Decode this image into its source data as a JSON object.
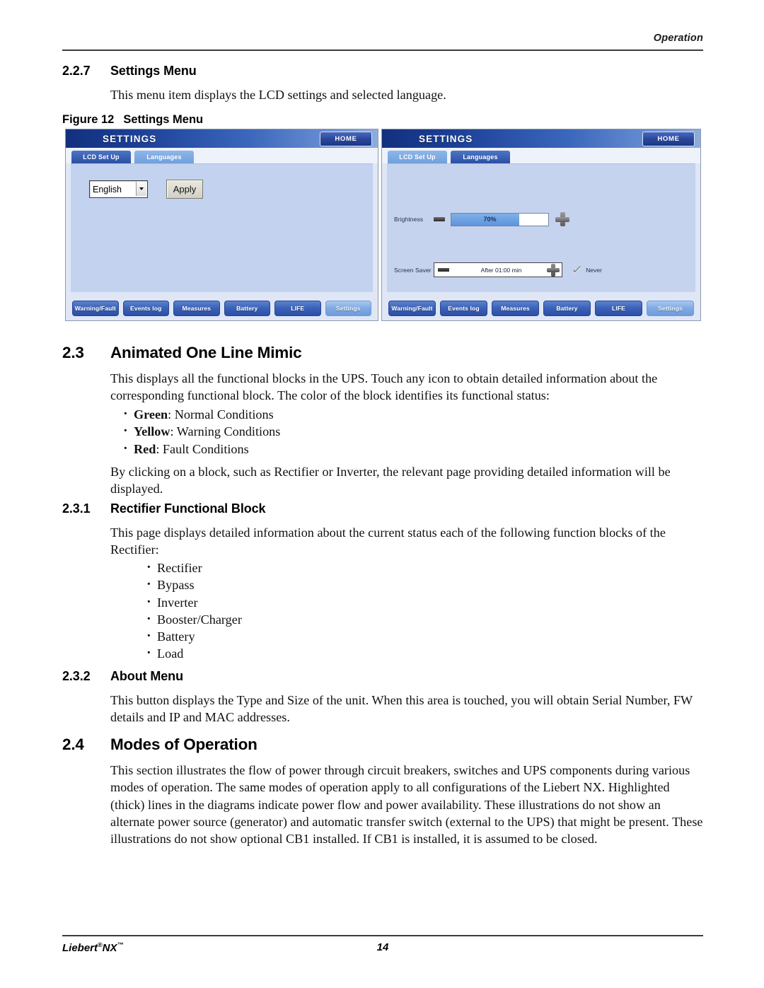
{
  "header": {
    "running_head": "Operation"
  },
  "sections": {
    "s227": {
      "number": "2.2.7",
      "title": "Settings Menu",
      "body": "This menu item displays the LCD settings and selected language."
    },
    "figure": {
      "label": "Figure 12",
      "title": "Settings Menu"
    },
    "s23": {
      "number": "2.3",
      "title": "Animated One Line Mimic",
      "body": "This displays all the functional blocks in the UPS. Touch any icon to obtain detailed information about the corresponding functional block. The color of the block identifies its functional status:",
      "bullets": [
        {
          "term": "Green",
          "rest": ": Normal Conditions"
        },
        {
          "term": "Yellow",
          "rest": ": Warning Conditions"
        },
        {
          "term": "Red",
          "rest": ": Fault Conditions"
        }
      ],
      "body2": "By clicking on a block, such as Rectifier or Inverter, the relevant page providing detailed information will be displayed."
    },
    "s231": {
      "number": "2.3.1",
      "title": "Rectifier Functional Block",
      "body": "This page displays detailed information about the current status each of the following function blocks of the Rectifier:",
      "bullets": [
        "Rectifier",
        "Bypass",
        "Inverter",
        "Booster/Charger",
        "Battery",
        "Load"
      ]
    },
    "s232": {
      "number": "2.3.2",
      "title": "About Menu",
      "body": "This button displays the Type and Size of the unit. When this area is touched, you will obtain Serial Number, FW details and IP and MAC addresses."
    },
    "s24": {
      "number": "2.4",
      "title": "Modes of Operation",
      "body": "This section illustrates the flow of power through circuit breakers, switches and UPS components during various modes of operation. The same modes of operation apply to all configurations of the Liebert NX. Highlighted (thick) lines in the diagrams indicate power flow and power availability. These illustrations do not show an alternate power source (generator) and automatic transfer switch (external to the UPS) that might be present. These illustrations do not show optional CB1 installed. If CB1 is installed, it is assumed to be closed."
    }
  },
  "lcd_left": {
    "title": "SETTINGS",
    "home_label": "HOME",
    "tabs": [
      {
        "label": "LCD Set Up",
        "active": false
      },
      {
        "label": "Languages",
        "active": true
      }
    ],
    "language_value": "English",
    "apply_label": "Apply",
    "nav": [
      {
        "label": "Warning/Fault",
        "active": false
      },
      {
        "label": "Events log",
        "active": false
      },
      {
        "label": "Measures",
        "active": false
      },
      {
        "label": "Battery",
        "active": false
      },
      {
        "label": "LIFE",
        "active": false
      },
      {
        "label": "Settings",
        "active": true
      }
    ]
  },
  "lcd_right": {
    "title": "SETTINGS",
    "home_label": "HOME",
    "tabs": [
      {
        "label": "LCD Set Up",
        "active": true
      },
      {
        "label": "Languages",
        "active": false
      }
    ],
    "brightness_label": "Brightness",
    "brightness_value": "70%",
    "brightness_percent": 70,
    "screensaver_label": "Screen Saver",
    "screensaver_value": "After 01:00 min",
    "never_label": "Never",
    "nav": [
      {
        "label": "Warning/Fault",
        "active": false
      },
      {
        "label": "Events log",
        "active": false
      },
      {
        "label": "Measures",
        "active": false
      },
      {
        "label": "Battery",
        "active": false
      },
      {
        "label": "LIFE",
        "active": false
      },
      {
        "label": "Settings",
        "active": true
      }
    ]
  },
  "footer": {
    "brand": "Liebert",
    "brand_reg": "®",
    "brand_nx": "NX",
    "brand_tm": "™",
    "page_number": "14"
  }
}
